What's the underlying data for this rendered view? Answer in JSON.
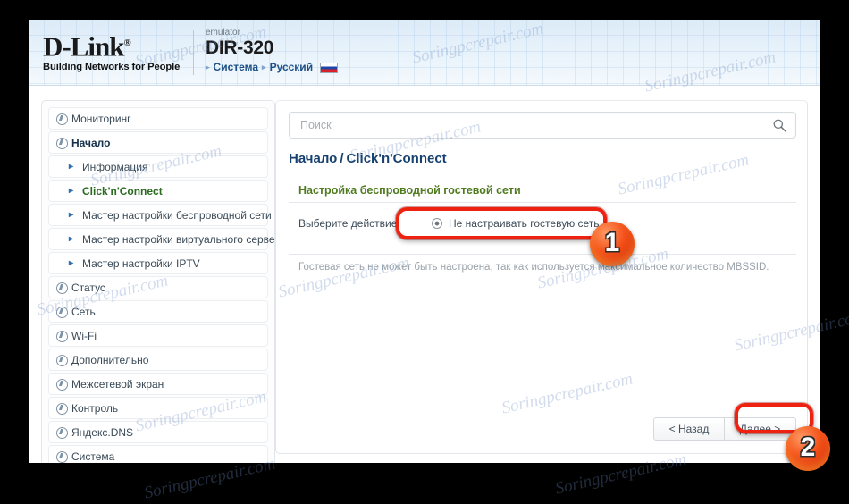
{
  "header": {
    "brand_name": "D-Link",
    "brand_registered": "®",
    "brand_tagline": "Building Networks for People",
    "emulator_label": "emulator",
    "model": "DIR-320",
    "nav": [
      {
        "label": "Система"
      },
      {
        "label": "Русский"
      }
    ],
    "arrow_glyph": "▸",
    "flag": "ru-flag"
  },
  "sidebar": {
    "items": [
      {
        "label": "Мониторинг",
        "type": "top",
        "state": "normal"
      },
      {
        "label": "Начало",
        "type": "top",
        "state": "active"
      },
      {
        "label": "Информация",
        "type": "sub",
        "state": "normal"
      },
      {
        "label": "Click'n'Connect",
        "type": "sub",
        "state": "selected"
      },
      {
        "label": "Мастер настройки беспроводной сети",
        "type": "sub",
        "state": "normal"
      },
      {
        "label": "Мастер настройки виртуального сервера",
        "type": "sub",
        "state": "normal"
      },
      {
        "label": "Мастер настройки IPTV",
        "type": "sub",
        "state": "normal"
      },
      {
        "label": "Статус",
        "type": "top",
        "state": "normal"
      },
      {
        "label": "Сеть",
        "type": "top",
        "state": "normal"
      },
      {
        "label": "Wi-Fi",
        "type": "top",
        "state": "normal"
      },
      {
        "label": "Дополнительно",
        "type": "top",
        "state": "normal"
      },
      {
        "label": "Межсетевой экран",
        "type": "top",
        "state": "normal"
      },
      {
        "label": "Контроль",
        "type": "top",
        "state": "normal"
      },
      {
        "label": "Яндекс.DNS",
        "type": "top",
        "state": "normal"
      },
      {
        "label": "Система",
        "type": "top",
        "state": "normal"
      }
    ]
  },
  "main": {
    "search": {
      "placeholder": "Поиск",
      "value": "",
      "icon": "search-icon"
    },
    "breadcrumb": {
      "root": "Начало",
      "separator": "/",
      "current": "Click'n'Connect"
    },
    "section_title": "Настройка беспроводной гостевой сети",
    "form": {
      "label": "Выберите действие:",
      "option_label": "Не настраивать гостевую сеть",
      "option_checked": true
    },
    "hint": "Гостевая сеть не может быть настроена, так как используется максимальное количество MBSSID.",
    "buttons": {
      "back": "< Назад",
      "next": "Далее >"
    }
  },
  "annotations": {
    "badges": [
      {
        "number": "1"
      },
      {
        "number": "2"
      }
    ],
    "highlight_color": "#ee2211",
    "badge_color": "#f4521b"
  },
  "watermark": {
    "text": "Soringpcrepair.com"
  },
  "colors": {
    "header_blue": "#dcebf8",
    "breadcrumb_blue": "#16406e",
    "section_green": "#4f7a1e",
    "selected_green": "#2a6b1f",
    "hint_gray": "#9aa2aa",
    "page_background": "#000000"
  }
}
